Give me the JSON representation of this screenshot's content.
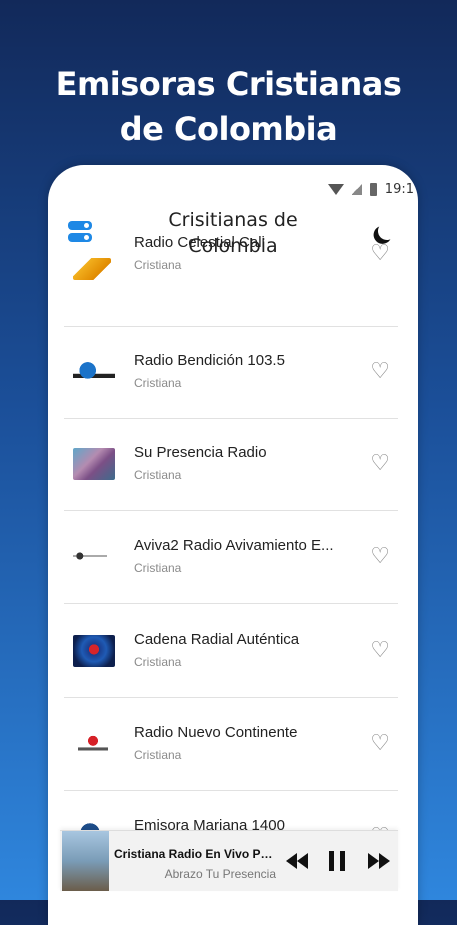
{
  "promo": {
    "line1": "Emisoras Cristianas",
    "line2": "de Colombia"
  },
  "status_bar": {
    "time": "19:1"
  },
  "app_bar": {
    "title_line1": "Crisitianas de",
    "title_line2": "Colombia"
  },
  "stations": [
    {
      "name": "Radio Celestial Cali",
      "category": "Cristiana"
    },
    {
      "name": "Radio Bendición 103.5",
      "category": "Cristiana"
    },
    {
      "name": "Su Presencia Radio",
      "category": "Cristiana"
    },
    {
      "name": "Aviva2 Radio Avivamiento E...",
      "category": "Cristiana"
    },
    {
      "name": "Cadena Radial Auténtica",
      "category": "Cristiana"
    },
    {
      "name": "Radio Nuevo Continente",
      "category": "Cristiana"
    },
    {
      "name": "Emisora Mariana 1400",
      "category": ""
    }
  ],
  "player": {
    "title": "Cristiana Radio En Vivo Par...",
    "subtitle": "Abrazo Tu Presencia"
  },
  "colors": {
    "accent": "#1e88e5",
    "bg_top": "#12295a",
    "bg_bottom": "#2f86dd"
  }
}
